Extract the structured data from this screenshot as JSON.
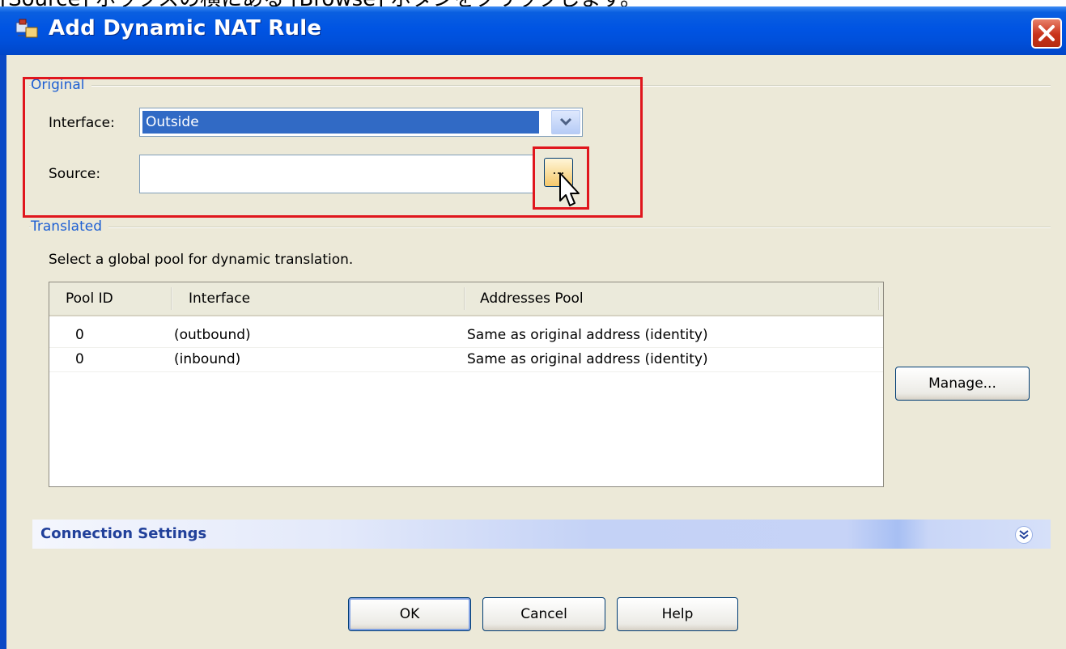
{
  "caption": "[Source] ボックスの横にある [Browse] ボタンをクリックします。",
  "window": {
    "title": "Add Dynamic NAT Rule"
  },
  "original": {
    "group_label": "Original",
    "interface_label": "Interface:",
    "interface_value": "Outside",
    "source_label": "Source:",
    "source_value": "",
    "browse_label": "..."
  },
  "translated": {
    "group_label": "Translated",
    "description": "Select a global pool for dynamic translation.",
    "columns": [
      "Pool ID",
      "Interface",
      "Addresses Pool"
    ],
    "rows": [
      {
        "pool_id": "0",
        "interface": "(outbound)",
        "addresses_pool": "Same as original address (identity)"
      },
      {
        "pool_id": "0",
        "interface": "(inbound)",
        "addresses_pool": "Same as original address (identity)"
      }
    ],
    "manage_label": "Manage..."
  },
  "connection_settings": {
    "label": "Connection Settings"
  },
  "buttons": {
    "ok": "OK",
    "cancel": "Cancel",
    "help": "Help"
  },
  "colors": {
    "titlebar": "#0054e3",
    "selection": "#316ac5",
    "highlight": "#e0161d",
    "group_label": "#1d5fd3",
    "dialog_bg": "#ece9d8"
  },
  "icons": {
    "title": "nat-rule-icon",
    "close": "close-icon",
    "dropdown": "chevron-down-icon",
    "cursor": "mouse-pointer-icon",
    "expand": "double-chevron-down-icon"
  }
}
